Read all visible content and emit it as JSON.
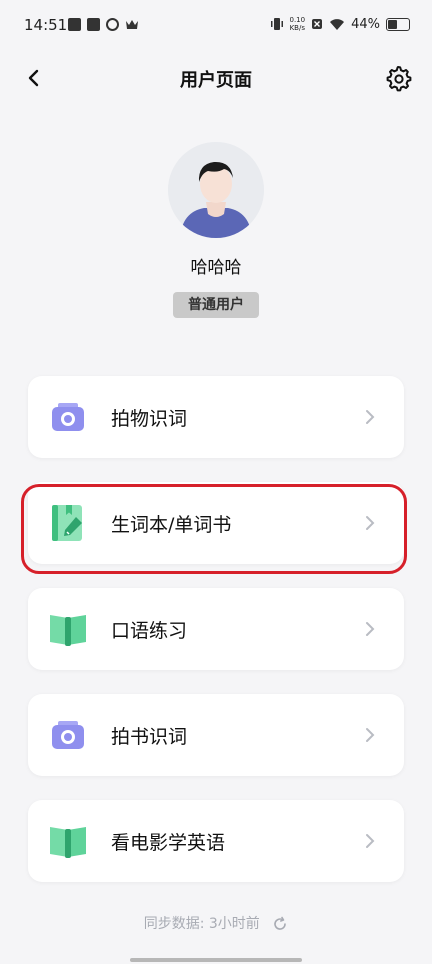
{
  "status_bar": {
    "time": "14:51",
    "net_speed_value": "0.10",
    "net_speed_unit": "KB/s",
    "battery_percent": "44%"
  },
  "header": {
    "title": "用户页面"
  },
  "profile": {
    "name": "哈哈哈",
    "badge": "普通用户"
  },
  "menu": {
    "items": [
      {
        "label": "拍物识词",
        "icon": "camera-icon"
      },
      {
        "label": "生词本/单词书",
        "icon": "notebook-pen-icon"
      },
      {
        "label": "口语练习",
        "icon": "open-book-icon"
      },
      {
        "label": "拍书识词",
        "icon": "camera-icon"
      },
      {
        "label": "看电影学英语",
        "icon": "open-book-icon"
      }
    ]
  },
  "footer": {
    "sync_text": "同步数据: 3小时前"
  },
  "colors": {
    "highlight": "#d6202a",
    "camera_purple": "#8f8fee",
    "book_green": "#5fd39a"
  }
}
